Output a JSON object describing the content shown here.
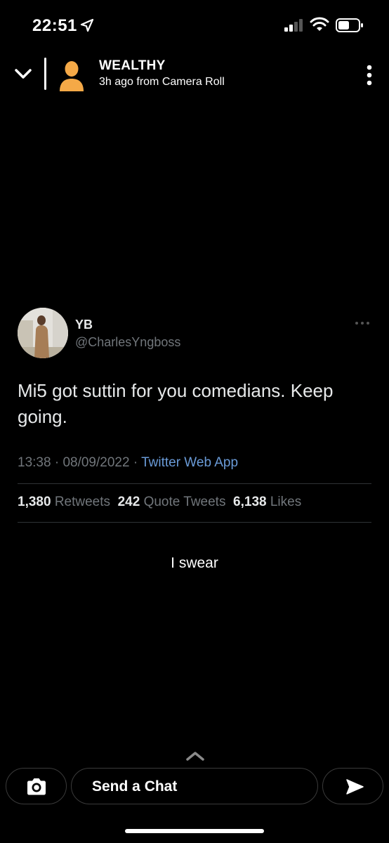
{
  "status_bar": {
    "time": "22:51",
    "icons": [
      "location-arrow-icon",
      "cell-signal-icon",
      "wifi-icon",
      "battery-icon"
    ]
  },
  "story": {
    "title": "WEALTHY",
    "subtitle": "3h ago from Camera Roll",
    "icons": [
      "chevron-down-icon",
      "avatar-icon",
      "more-vertical-icon"
    ]
  },
  "tweet": {
    "name": "YB",
    "handle": "@CharlesYngboss",
    "text": "Mi5 got suttin for you comedians. Keep going.",
    "time": "13:38",
    "separator": "·",
    "date": "08/09/2022",
    "source": "Twitter Web App",
    "stats": {
      "retweets_count": "1,380",
      "retweets_label": "Retweets",
      "quotes_count": "242",
      "quotes_label": "Quote Tweets",
      "likes_count": "6,138",
      "likes_label": "Likes"
    },
    "colors": {
      "source_link": "#6a9bd8",
      "secondary_text": "#71767b"
    }
  },
  "caption": "I swear",
  "bottom_bar": {
    "chat_placeholder": "Send a Chat",
    "icons": [
      "chevron-up-icon",
      "camera-icon",
      "send-icon"
    ]
  }
}
